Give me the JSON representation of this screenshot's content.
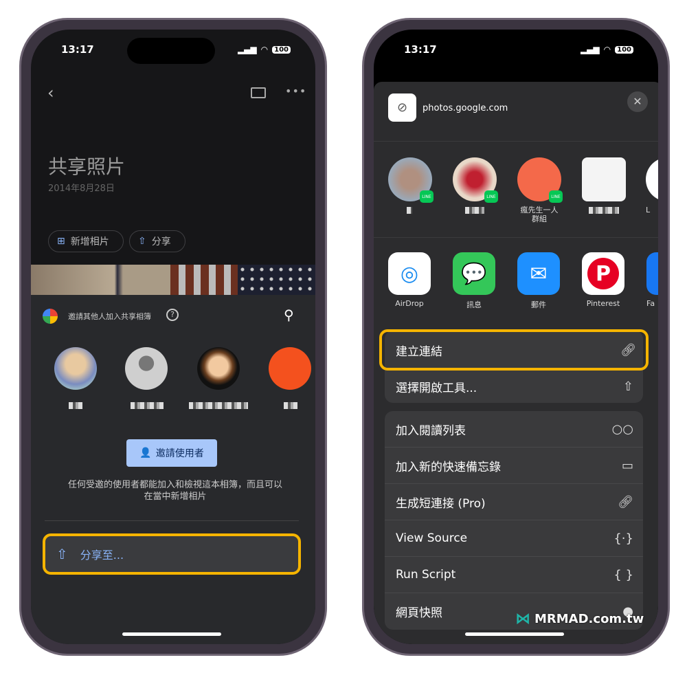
{
  "status": {
    "time": "13:17",
    "battery": "100"
  },
  "left": {
    "title": "共享照片",
    "date": "2014年8月28日",
    "add_photos": "新增相片",
    "share": "分享",
    "invite_header": "邀請其他人加入共享相簿",
    "invite_button": "邀請使用者",
    "description_line1": "任何受邀的使用者都能加入和檢視這本相簿，而且可以",
    "description_line2": "在當中新增相片",
    "share_to": "分享至..."
  },
  "right": {
    "url": "photos.google.com",
    "contacts": [
      {
        "name": ""
      },
      {
        "name": ""
      },
      {
        "name": "瘋先生一人\n群組",
        "name1": "瘋先生一人",
        "name2": "群組"
      },
      {
        "name": ""
      },
      {
        "name": "L"
      }
    ],
    "apps": [
      {
        "label": "AirDrop"
      },
      {
        "label": "訊息"
      },
      {
        "label": "郵件"
      },
      {
        "label": "Pinterest"
      },
      {
        "label": "Fa"
      }
    ],
    "actions_group1": [
      {
        "label": "建立連結",
        "icon": "link-icon"
      },
      {
        "label": "選擇開啟工具...",
        "icon": "share-icon"
      }
    ],
    "actions_group2": [
      {
        "label": "加入閱讀列表",
        "icon": "glasses-icon"
      },
      {
        "label": "加入新的快速備忘錄",
        "icon": "quick-note-icon"
      },
      {
        "label": "生成短連接 (Pro)",
        "icon": "link-icon"
      },
      {
        "label": "View Source",
        "icon": "source-icon"
      },
      {
        "label": "Run Script",
        "icon": "braces-icon"
      },
      {
        "label": "網頁快照",
        "icon": "snapshot-icon"
      }
    ]
  },
  "watermark": "MRMAD.com.tw",
  "colors": {
    "highlight": "#f5b400",
    "invite_button": "#a8c7fa",
    "sheet": "#2c2c2e"
  }
}
